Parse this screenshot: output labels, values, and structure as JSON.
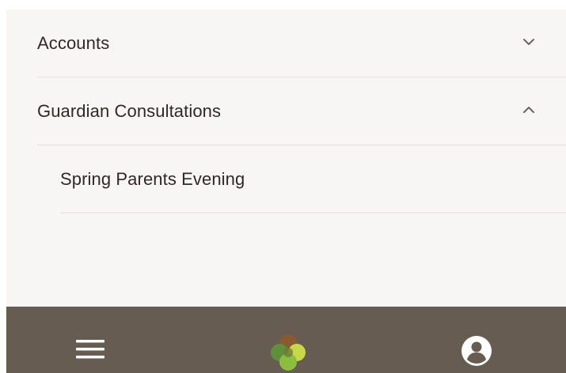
{
  "menu": {
    "items": [
      {
        "label": "Accounts",
        "state": "collapsed",
        "chevron_icon": "chevron-down-icon"
      },
      {
        "label": "Guardian Consultations",
        "state": "expanded",
        "chevron_icon": "chevron-up-icon",
        "children": [
          {
            "label": "Spring Parents Evening"
          }
        ]
      }
    ]
  },
  "bottom_bar": {
    "menu_icon": "hamburger-menu-icon",
    "logo_icon": "clover-logo-icon",
    "profile_icon": "user-profile-icon",
    "background_color": "#675c52"
  },
  "colors": {
    "page_background": "#f7f6f4",
    "text": "#2e2a26",
    "divider": "#e3e0dc"
  }
}
